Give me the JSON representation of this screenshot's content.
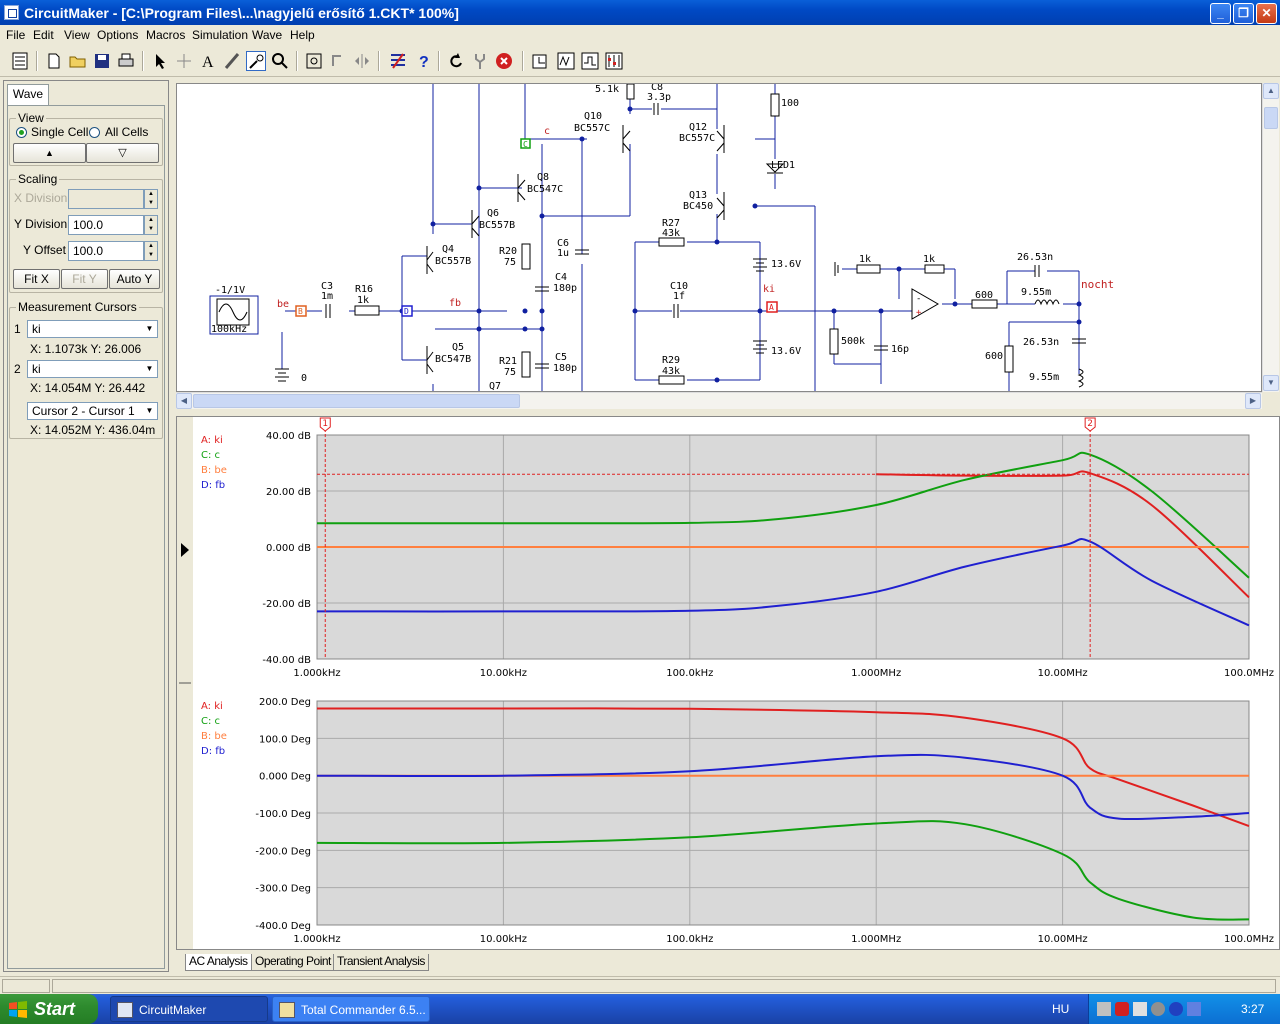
{
  "window": {
    "title": "CircuitMaker - [C:\\Program Files\\...\\nagyjelű erősítő 1.CKT* 100%]",
    "buttons": [
      "_",
      "❐",
      "✕"
    ]
  },
  "menu": [
    "File",
    "Edit",
    "View",
    "Options",
    "Macros",
    "Simulation",
    "Wave",
    "Help"
  ],
  "toolbar": {
    "icons": [
      "component-list-icon",
      "new-icon",
      "open-icon",
      "save-icon",
      "print-icon",
      "arrow-tool-icon",
      "wire-tool-icon",
      "text-tool-icon",
      "probe-tool-icon",
      "wave-tool-icon",
      "zoom-tool-icon",
      "zoom-fit-icon",
      "rotate-icon",
      "mirror-icon",
      "netlist-icon",
      "help-icon",
      "undo-icon",
      "trace-icon",
      "stop-icon",
      "run-icon",
      "step-icon",
      "analysis-icon",
      "setup-icon"
    ]
  },
  "left_panel": {
    "tab": "Wave",
    "view": {
      "label": "View",
      "single_cell": "Single Cell",
      "all_cells": "All Cells",
      "up": "▲",
      "down": "▽"
    },
    "scaling": {
      "label": "Scaling",
      "x_division_label": "X Division",
      "x_division_value": "",
      "y_division_label": "Y Division",
      "y_division_value": "100.0",
      "y_offset_label": "Y Offset",
      "y_offset_value": "100.0",
      "fit_x": "Fit X",
      "fit_y": "Fit Y",
      "auto_y": "Auto Y"
    },
    "cursors": {
      "label": "Measurement Cursors",
      "c1_num": "1",
      "c1_trace": "ki",
      "c1_readout": "X: 1.1073k  Y: 26.006",
      "c2_num": "2",
      "c2_trace": "ki",
      "c2_readout": "X: 14.054M  Y: 26.442",
      "diff_mode": "Cursor 2 - Cursor 1",
      "diff_readout": "X: 14.052M  Y: 436.04m"
    }
  },
  "schematic": {
    "labels": {
      "source_amp": "-1/1V",
      "source_freq": "100kHz",
      "be": "be",
      "fb": "fb",
      "c_net": "c",
      "ki": "ki",
      "nocht": "nocht",
      "gnd0": "0",
      "c3": "C3",
      "c3v": "1m",
      "r16": "R16",
      "r16v": "1k",
      "q4": "Q4",
      "q4t": "BC557B",
      "q5": "Q5",
      "q5t": "BC547B",
      "q6": "Q6",
      "q6t": "BC557B",
      "q7": "Q7",
      "q8": "Q8",
      "q8t": "BC547C",
      "q10": "Q10",
      "q10t": "BC557C",
      "q12": "Q12",
      "q12t": "BC557C",
      "q13": "Q13",
      "q13t": "BC450",
      "r20": "R20",
      "r20v": "75",
      "r21": "R21",
      "r21v": "75",
      "c4": "C4",
      "c4v": "180p",
      "c5": "C5",
      "c5v": "180p",
      "c6": "C6",
      "c6v": "1u",
      "c8": "C8",
      "c8v": "3.3p",
      "r51": "5.1k",
      "r100": "100",
      "led1": "LED1",
      "r27": "R27",
      "r27v": "43k",
      "r29": "R29",
      "r29v": "43k",
      "c10": "C10",
      "c10v": "1f",
      "v1": "13.6V",
      "v2": "13.6V",
      "r500k": "500k",
      "c16p": "16p",
      "r1k_a": "1k",
      "r1k_b": "1k",
      "r600a": "600",
      "r600b": "600",
      "c2653a": "26.53n",
      "c2653b": "26.53n",
      "l955a": "9.55m",
      "l955b": "9.55m",
      "probeA": "A",
      "probeB": "B",
      "probeC": "C",
      "probeD": "D"
    }
  },
  "waves": {
    "legend": [
      {
        "key": "A: ki",
        "color": "#e02020"
      },
      {
        "key": "C: c",
        "color": "#10a010"
      },
      {
        "key": "B: be",
        "color": "#ff7f3f"
      },
      {
        "key": "D: fb",
        "color": "#2020d0"
      }
    ],
    "cursor1_label": "1",
    "cursor2_label": "2",
    "x_ticks": [
      "1.000kHz",
      "10.00kHz",
      "100.0kHz",
      "1.000MHz",
      "10.00MHz",
      "100.0MHz"
    ],
    "mag_y_ticks": [
      "40.00 dB",
      "20.00 dB",
      "0.000 dB",
      "-20.00 dB",
      "-40.00 dB"
    ],
    "phase_y_ticks": [
      "200.0 Deg",
      "100.0 Deg",
      "0.000 Deg",
      "-100.0 Deg",
      "-200.0 Deg",
      "-300.0 Deg",
      "-400.0 Deg"
    ]
  },
  "chart_data": [
    {
      "type": "line",
      "title": "",
      "xlabel": "",
      "ylabel": "",
      "x_scale": "log",
      "xlim": [
        1000,
        100000000
      ],
      "ylim": [
        -40,
        40
      ],
      "x": [
        1000,
        10000,
        100000,
        300000,
        1000000,
        3000000,
        10000000,
        14000000,
        30000000,
        100000000
      ],
      "series": [
        {
          "name": "A: ki",
          "values": [
            null,
            null,
            null,
            null,
            26,
            25.5,
            25.5,
            26.4,
            15,
            -18
          ]
        },
        {
          "name": "C: c",
          "values": [
            8.5,
            8.5,
            8.6,
            10,
            15,
            24,
            31,
            33,
            20,
            -11
          ]
        },
        {
          "name": "B: be",
          "values": [
            0,
            0,
            0,
            0,
            0,
            0,
            0,
            0,
            0,
            0
          ]
        },
        {
          "name": "D: fb",
          "values": [
            -23,
            -23,
            -22.8,
            -21,
            -16,
            -7,
            0.5,
            2,
            -12,
            -28
          ]
        }
      ],
      "cursors": [
        1107.3,
        14054000
      ],
      "cursor_level": 26,
      "grid": true
    },
    {
      "type": "line",
      "title": "",
      "xlabel": "",
      "ylabel": "",
      "x_scale": "log",
      "xlim": [
        1000,
        100000000
      ],
      "ylim": [
        -400,
        200
      ],
      "x": [
        1000,
        10000,
        100000,
        1000000,
        3000000,
        10000000,
        14000000,
        20000000,
        50000000,
        100000000
      ],
      "series": [
        {
          "name": "A: ki",
          "values": [
            180,
            180,
            179,
            170,
            155,
            100,
            20,
            -10,
            -80,
            -135
          ]
        },
        {
          "name": "C: c",
          "values": [
            -180,
            -180,
            -165,
            -128,
            -130,
            -210,
            -285,
            -330,
            -380,
            -385
          ]
        },
        {
          "name": "B: be",
          "values": [
            0,
            0,
            0,
            0,
            0,
            0,
            0,
            0,
            0,
            0
          ]
        },
        {
          "name": "D: fb",
          "values": [
            0,
            0,
            12,
            52,
            48,
            0,
            -85,
            -115,
            -110,
            -100
          ]
        }
      ],
      "grid": true
    }
  ],
  "tabs": [
    "AC Analysis",
    "Operating Point",
    "Transient Analysis"
  ],
  "taskbar": {
    "start": "Start",
    "tasks": [
      "CircuitMaker",
      "Total Commander 6.5..."
    ],
    "lang": "HU",
    "time": "3:27"
  }
}
